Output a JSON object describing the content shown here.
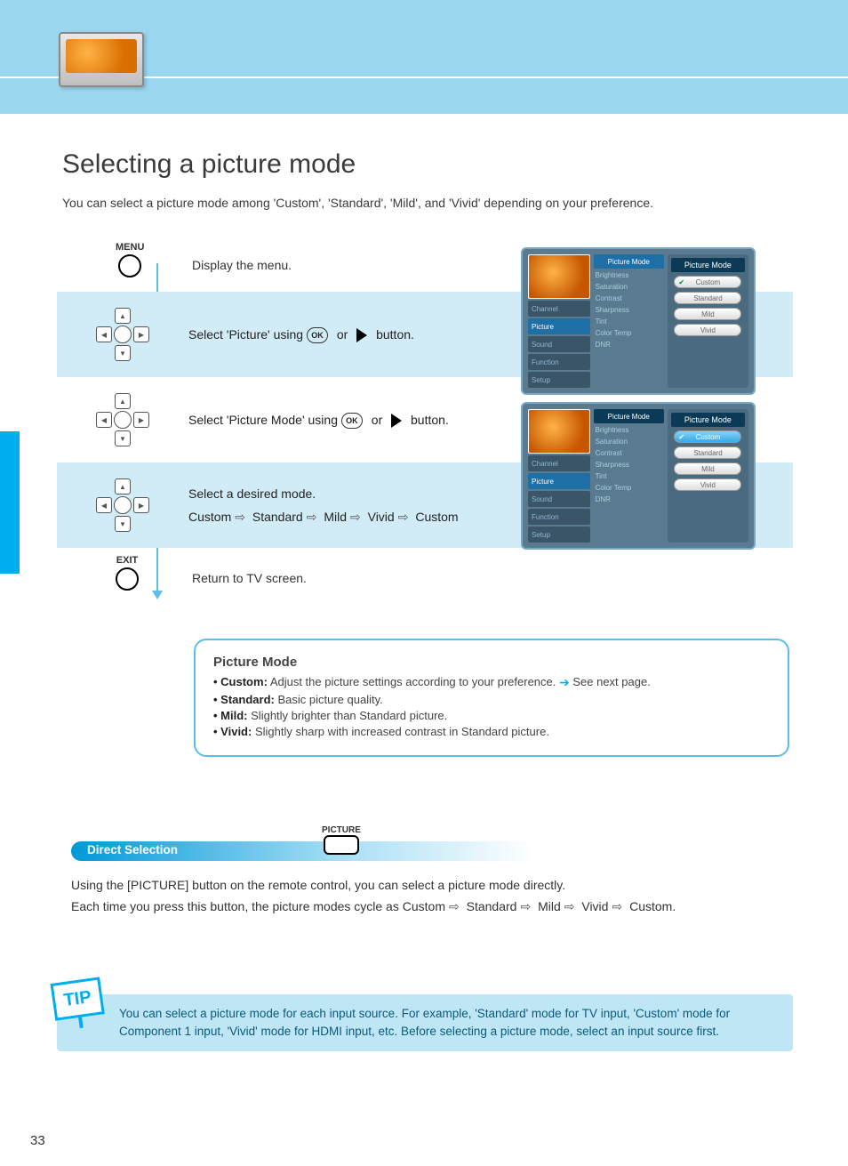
{
  "header": {
    "page_title": "Selecting a picture mode",
    "intro": "You can select a picture mode among 'Custom', 'Standard', 'Mild', and 'Vivid' depending on your preference."
  },
  "steps": {
    "menu_label": "MENU",
    "menu_desc": "Display the menu.",
    "row1": {
      "pre": "Select 'Picture' using",
      "action_a": "or",
      "tail": "button."
    },
    "row2": {
      "pre": "Select 'Picture Mode' using",
      "action_a": "or",
      "tail": "button."
    },
    "row3": {
      "pre": "Select a desired mode.",
      "cycle": [
        "Custom",
        "Standard",
        "Mild",
        "Vivid",
        "Custom"
      ]
    },
    "exit_label": "EXIT",
    "exit_desc": "Return to TV screen."
  },
  "osd": {
    "tabs": [
      "Channel",
      "Picture",
      "Sound",
      "Function",
      "Setup"
    ],
    "mid_header": "Picture Mode",
    "mid_items": [
      "Brightness",
      "Saturation",
      "Contrast",
      "Sharpness",
      "Tint",
      "Color Temp",
      "DNR"
    ],
    "right_header": "Picture Mode",
    "options": [
      "Custom",
      "Standard",
      "Mild",
      "Vivid"
    ],
    "selected": "Custom"
  },
  "info": {
    "title": "Picture Mode",
    "line1a": "Custom",
    "line1b": "Adjust the picture settings according to your preference. ",
    "line1c": " See next page.",
    "line2a": "Standard",
    "line2b": "Basic picture quality.",
    "line3a": "Mild",
    "line3b": "Slightly brighter than Standard picture.",
    "line4a": "Vivid",
    "line4b": "Slightly sharp with increased contrast in Standard picture."
  },
  "direct": {
    "title": "Direct Selection",
    "btn_label": "PICTURE",
    "line1": "Using the [PICTURE] button on the remote control, you can select a picture mode directly.",
    "line2a": "Each time you press this button, the picture modes cycle as ",
    "cycle": [
      "Custom",
      "Standard",
      "Mild",
      "Vivid",
      "Custom"
    ]
  },
  "tip": {
    "badge": "TIP",
    "line1": "You can select a picture mode for each input source. For example, 'Standard' mode for TV input, 'Custom' mode for",
    "line2": "Component 1 input, 'Vivid' mode for HDMI input, etc. Before selecting a picture mode, select an input source first."
  },
  "page_number": "33"
}
